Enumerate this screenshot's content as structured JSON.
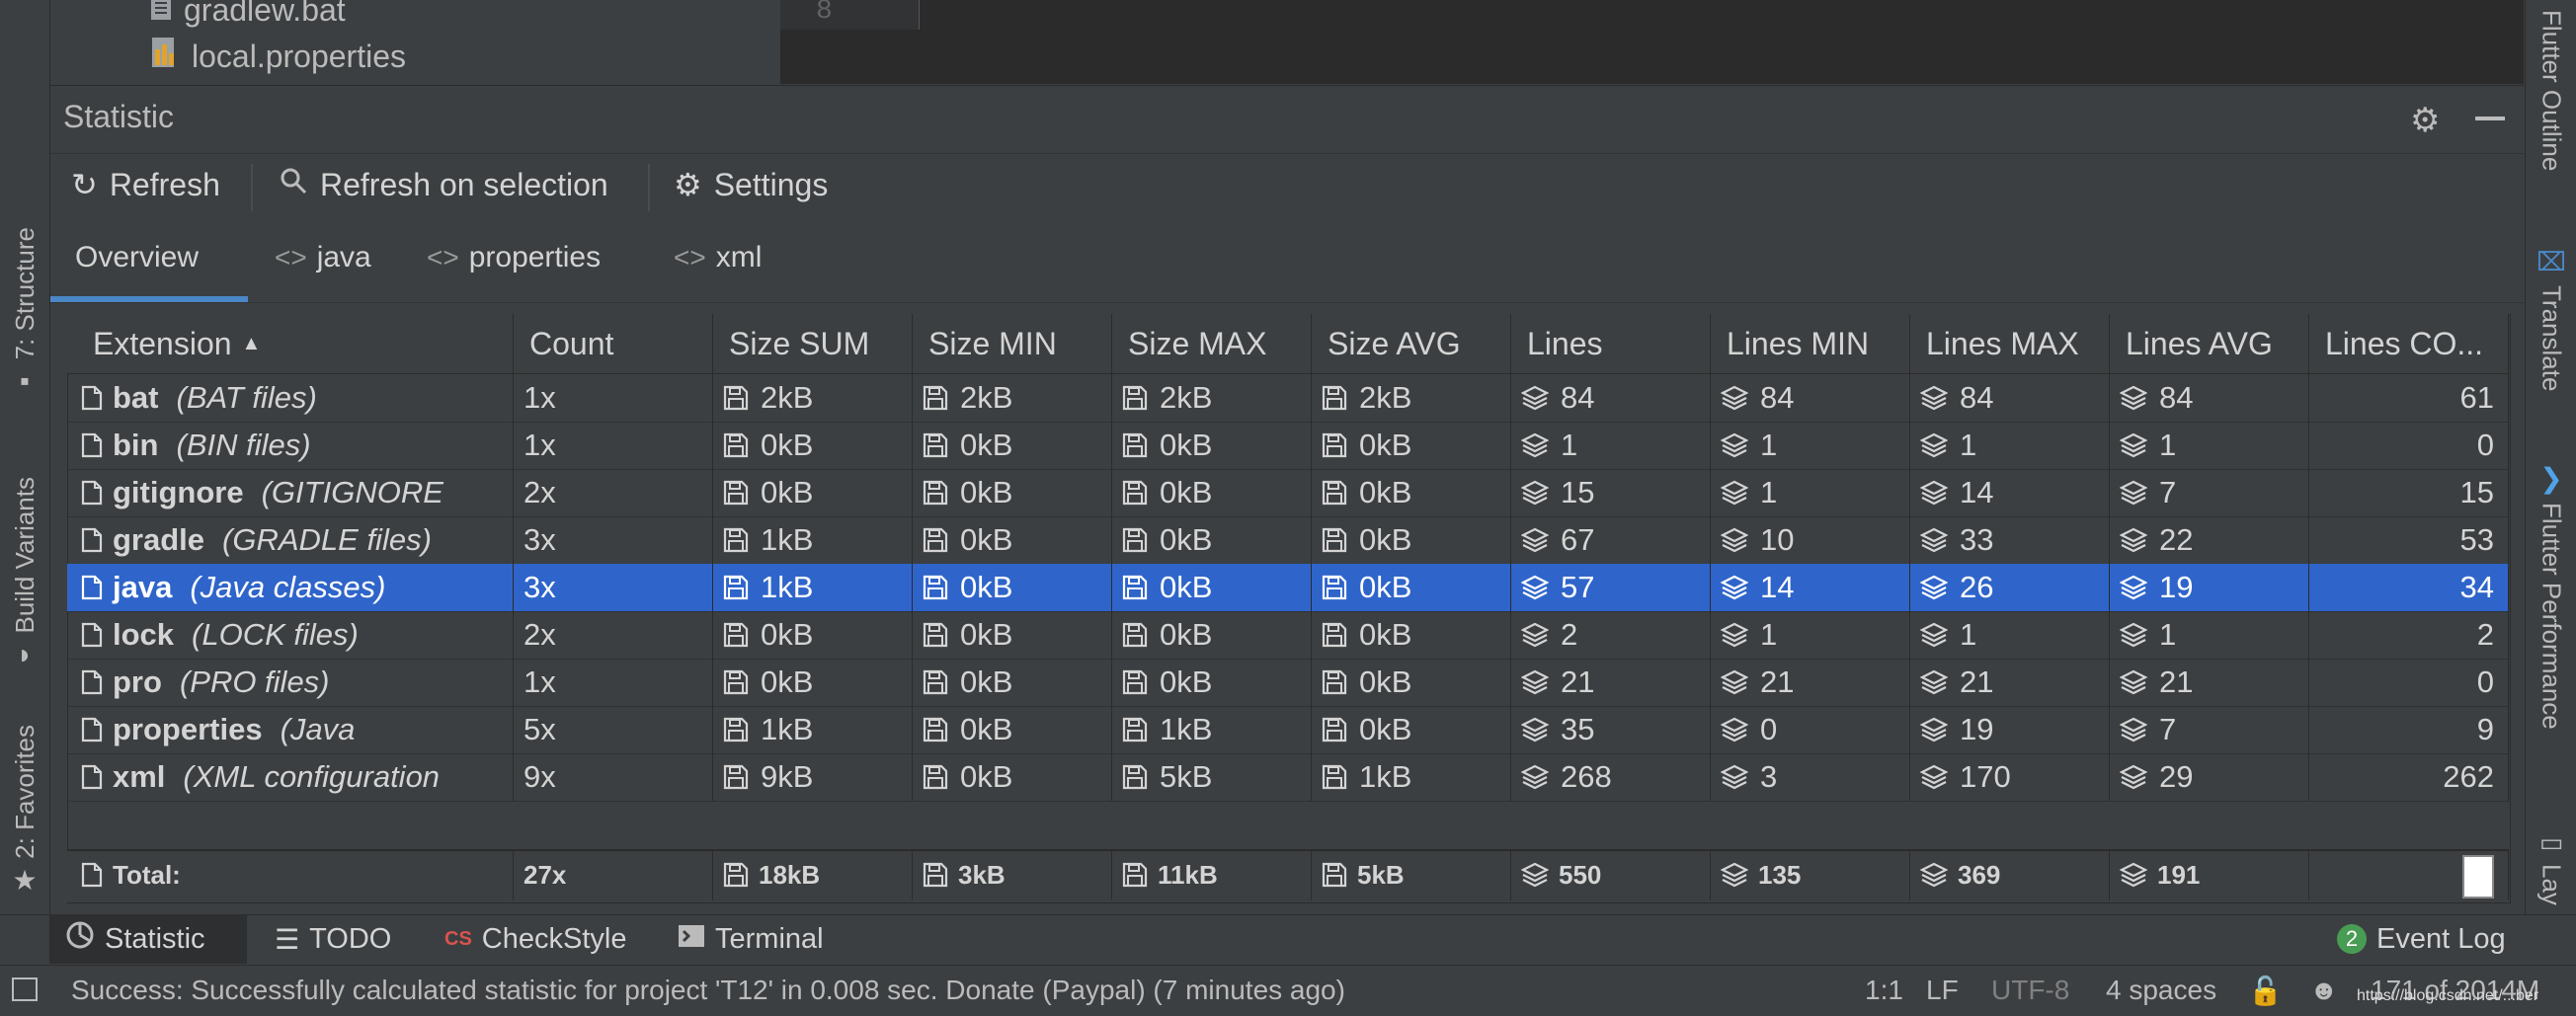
{
  "colors": {
    "accent": "#4a88c7",
    "selection": "#2f65ca",
    "background": "#3c3f41",
    "editor_bg": "#2b2b2b"
  },
  "left_tabs": [
    {
      "label": "7: Structure",
      "icon": "structure-icon"
    },
    {
      "label": "Build Variants",
      "icon": "android-icon"
    },
    {
      "label": "2: Favorites",
      "icon": "star-icon"
    }
  ],
  "right_tabs": [
    {
      "label": "Flutter Outline"
    },
    {
      "label": "Translate"
    },
    {
      "label": "Flutter Performance"
    },
    {
      "label": "Lay"
    }
  ],
  "project_tree": {
    "items": [
      {
        "label": "gradlew.bat",
        "icon": "file-icon"
      },
      {
        "label": "local.properties",
        "icon": "properties-file-icon"
      }
    ]
  },
  "editor": {
    "line_number": "8"
  },
  "panel": {
    "title": "Statistic",
    "toolbar": {
      "refresh": "Refresh",
      "refresh_on_selection": "Refresh on selection",
      "settings": "Settings"
    },
    "tabs": [
      "Overview",
      "java",
      "properties",
      "xml"
    ],
    "active_tab": "Overview"
  },
  "table": {
    "columns": [
      "Extension",
      "Count",
      "Size SUM",
      "Size MIN",
      "Size MAX",
      "Size AVG",
      "Lines",
      "Lines MIN",
      "Lines MAX",
      "Lines AVG",
      "Lines CO..."
    ],
    "sort_column": "Extension",
    "rows": [
      {
        "ext": "bat",
        "desc": "(BAT files)",
        "count": "1x",
        "size_sum": "2kB",
        "size_min": "2kB",
        "size_max": "2kB",
        "size_avg": "2kB",
        "lines": "84",
        "lines_min": "84",
        "lines_max": "84",
        "lines_avg": "84",
        "lines_co": "61"
      },
      {
        "ext": "bin",
        "desc": "(BIN files)",
        "count": "1x",
        "size_sum": "0kB",
        "size_min": "0kB",
        "size_max": "0kB",
        "size_avg": "0kB",
        "lines": "1",
        "lines_min": "1",
        "lines_max": "1",
        "lines_avg": "1",
        "lines_co": "0"
      },
      {
        "ext": "gitignore",
        "desc": "(GITIGNORE",
        "count": "2x",
        "size_sum": "0kB",
        "size_min": "0kB",
        "size_max": "0kB",
        "size_avg": "0kB",
        "lines": "15",
        "lines_min": "1",
        "lines_max": "14",
        "lines_avg": "7",
        "lines_co": "15"
      },
      {
        "ext": "gradle",
        "desc": "(GRADLE files)",
        "count": "3x",
        "size_sum": "1kB",
        "size_min": "0kB",
        "size_max": "0kB",
        "size_avg": "0kB",
        "lines": "67",
        "lines_min": "10",
        "lines_max": "33",
        "lines_avg": "22",
        "lines_co": "53"
      },
      {
        "ext": "java",
        "desc": "(Java classes)",
        "count": "3x",
        "size_sum": "1kB",
        "size_min": "0kB",
        "size_max": "0kB",
        "size_avg": "0kB",
        "lines": "57",
        "lines_min": "14",
        "lines_max": "26",
        "lines_avg": "19",
        "lines_co": "34",
        "selected": true
      },
      {
        "ext": "lock",
        "desc": "(LOCK files)",
        "count": "2x",
        "size_sum": "0kB",
        "size_min": "0kB",
        "size_max": "0kB",
        "size_avg": "0kB",
        "lines": "2",
        "lines_min": "1",
        "lines_max": "1",
        "lines_avg": "1",
        "lines_co": "2"
      },
      {
        "ext": "pro",
        "desc": "(PRO files)",
        "count": "1x",
        "size_sum": "0kB",
        "size_min": "0kB",
        "size_max": "0kB",
        "size_avg": "0kB",
        "lines": "21",
        "lines_min": "21",
        "lines_max": "21",
        "lines_avg": "21",
        "lines_co": "0"
      },
      {
        "ext": "properties",
        "desc": "(Java",
        "count": "5x",
        "size_sum": "1kB",
        "size_min": "0kB",
        "size_max": "1kB",
        "size_avg": "0kB",
        "lines": "35",
        "lines_min": "0",
        "lines_max": "19",
        "lines_avg": "7",
        "lines_co": "9"
      },
      {
        "ext": "xml",
        "desc": "(XML configuration",
        "count": "9x",
        "size_sum": "9kB",
        "size_min": "0kB",
        "size_max": "5kB",
        "size_avg": "1kB",
        "lines": "268",
        "lines_min": "3",
        "lines_max": "170",
        "lines_avg": "29",
        "lines_co": "262"
      }
    ],
    "total": {
      "label": "Total:",
      "count": "27x",
      "size_sum": "18kB",
      "size_min": "3kB",
      "size_max": "11kB",
      "size_avg": "5kB",
      "lines": "550",
      "lines_min": "135",
      "lines_max": "369",
      "lines_avg": "191"
    }
  },
  "bottom_tabs": [
    "Statistic",
    "TODO",
    "CheckStyle",
    "Terminal"
  ],
  "event_log": {
    "label": "Event Log",
    "badge": "2"
  },
  "status_bar": {
    "message": "Success: Successfully calculated statistic for project 'T12' in 0.008 sec. Donate (Paypal) (7 minutes ago)",
    "position": "1:1",
    "line_sep": "LF",
    "encoding": "UTF-8",
    "indent": "4 spaces",
    "memory": "171 of 2014M",
    "watermark": "https://blog.csdn.net/...ber"
  }
}
